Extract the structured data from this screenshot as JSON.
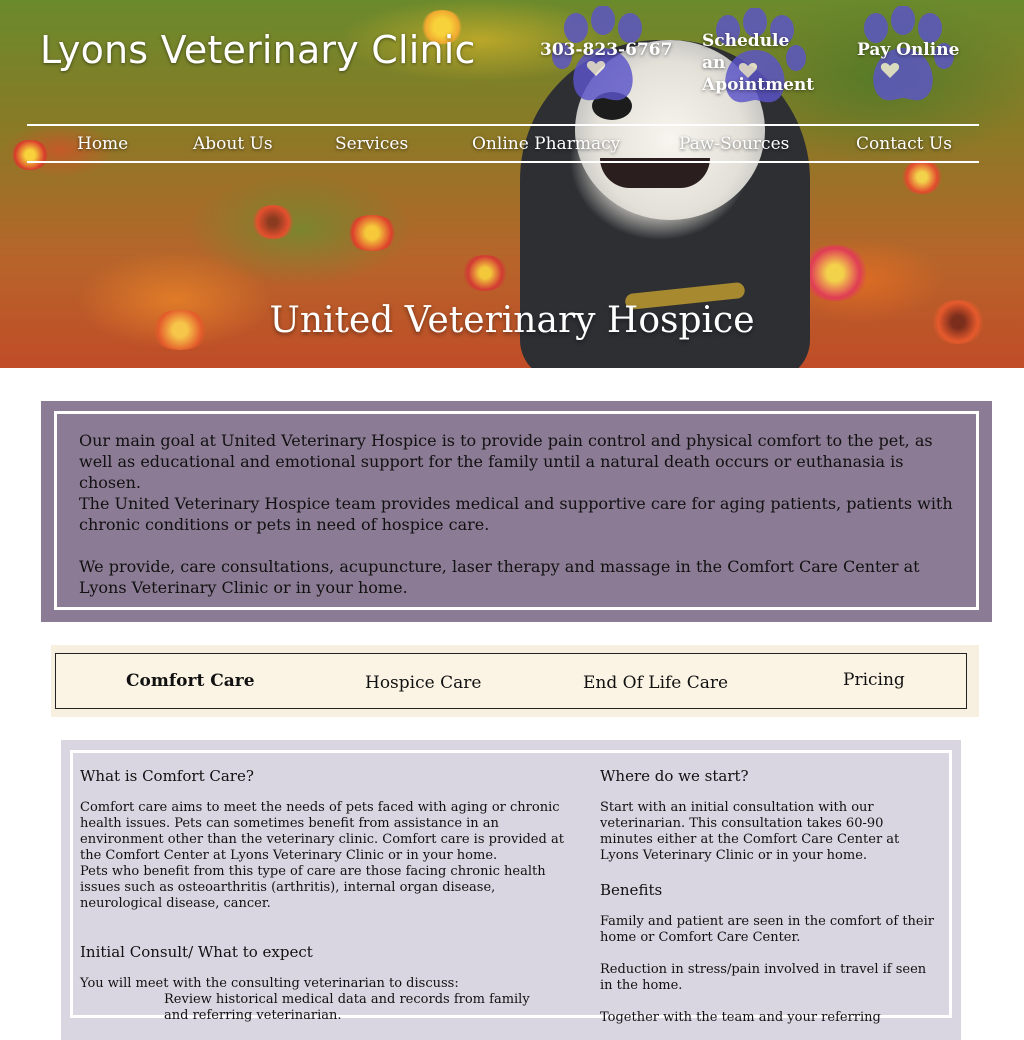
{
  "header": {
    "brand": "Lyons Veterinary Clinic",
    "phone": "303-823-6767",
    "schedule": "Schedule an Apointment",
    "pay": "Pay Online",
    "paw_color": "#5b54c9"
  },
  "nav": {
    "items": [
      {
        "label": "Home"
      },
      {
        "label": "About Us"
      },
      {
        "label": "Services"
      },
      {
        "label": "Online Pharmacy"
      },
      {
        "label": "Paw-Sources"
      },
      {
        "label": "Contact Us"
      }
    ]
  },
  "hero": {
    "title": "United Veterinary Hospice"
  },
  "intro": {
    "p1": "Our main goal at United Veterinary Hospice is to provide pain control and physical comfort to the pet, as well as educational and emotional support for the family until a natural death occurs or euthanasia is chosen.",
    "p2": "The United Veterinary Hospice team provides medical and supportive care for aging patients, patients with chronic conditions or pets in need of hospice care.",
    "p3": "We provide, care consultations, acupuncture, laser therapy and massage in the Comfort Care Center at Lyons Veterinary Clinic or in your home.",
    "bg_color": "#8b7b94"
  },
  "tabs": [
    {
      "label": "Comfort Care",
      "active": true
    },
    {
      "label": "Hospice Care",
      "active": false
    },
    {
      "label": "End Of Life Care",
      "active": false
    },
    {
      "label": "Pricing",
      "active": false
    }
  ],
  "content": {
    "left": {
      "h1": "What is Comfort Care?",
      "p1": "Comfort care aims to meet the needs of pets faced with aging or chronic health issues. Pets can sometimes benefit from assistance in an environment other than the veterinary clinic. Comfort care is provided at the Comfort Center at Lyons Veterinary Clinic or in your home.",
      "p2": "Pets who benefit from this type of care are those facing chronic health issues such as osteoarthritis (arthritis), internal organ disease, neurological disease, cancer.",
      "h2": "Initial Consult/ What to expect",
      "p3": "You will meet with the consulting veterinarian to discuss:",
      "li1": "Review historical medical data and records from family and referring veterinarian."
    },
    "right": {
      "h1": "Where do we start?",
      "p1": "Start with an initial consultation with our veterinarian. This consultation takes 60-90 minutes either at the Comfort Care Center at Lyons Veterinary Clinic or in your home.",
      "h2": "Benefits",
      "p2": "Family and patient are seen in the comfort of their home or Comfort Care Center.",
      "p3": "Reduction in stress/pain involved in travel if seen in the home.",
      "p4": "Together with the team and your referring"
    }
  }
}
